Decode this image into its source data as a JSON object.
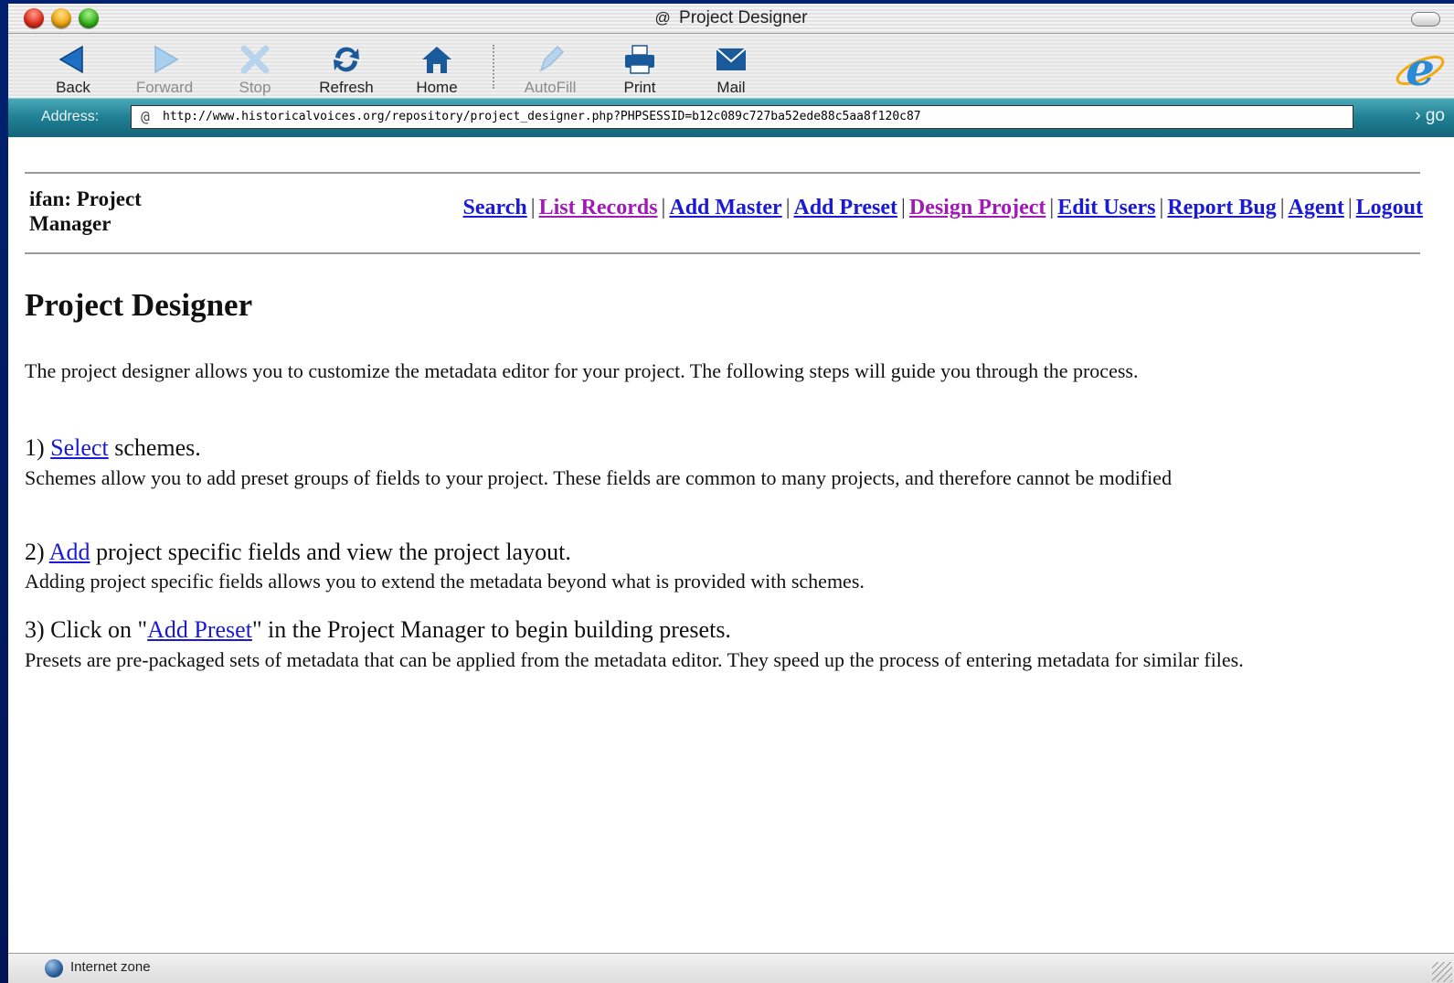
{
  "window": {
    "title": "Project Designer",
    "title_icon": "@"
  },
  "toolbar": {
    "back": "Back",
    "forward": "Forward",
    "stop": "Stop",
    "refresh": "Refresh",
    "home": "Home",
    "autofill": "AutoFill",
    "print": "Print",
    "mail": "Mail"
  },
  "address": {
    "label": "Address:",
    "url": "http://www.historicalvoices.org/repository/project_designer.php?PHPSESSID=b12c089c727ba52ede88c5aa8f120c87",
    "go": "go"
  },
  "page": {
    "manager_title": "ifan: Project Manager",
    "nav": [
      {
        "label": "Search",
        "visited": false
      },
      {
        "label": "List Records",
        "visited": true
      },
      {
        "label": "Add Master",
        "visited": false
      },
      {
        "label": "Add Preset",
        "visited": false
      },
      {
        "label": "Design Project",
        "visited": true
      },
      {
        "label": "Edit Users",
        "visited": false
      },
      {
        "label": "Report Bug",
        "visited": false
      },
      {
        "label": "Agent",
        "visited": false
      },
      {
        "label": "Logout",
        "visited": false
      }
    ],
    "heading": "Project Designer",
    "intro": "The project designer allows you to customize the metadata editor for your project. The following steps will guide you through the process.",
    "step1": {
      "prefix": "1) ",
      "link": "Select",
      "suffix": " schemes.",
      "desc": "Schemes allow you to add preset groups of fields to your project. These fields are common to many projects, and therefore cannot be modified"
    },
    "step2": {
      "prefix": "2) ",
      "link": "Add",
      "suffix": " project specific fields and view the project layout.",
      "desc": "Adding project specific fields allows you to extend the metadata beyond what is provided with schemes."
    },
    "step3": {
      "prefix": "3) Click on \"",
      "link": "Add Preset",
      "suffix": "\" in the Project Manager to begin building presets.",
      "desc": "Presets are pre-packaged sets of metadata that can be applied from the metadata editor. They speed up the process of entering metadata for similar files."
    }
  },
  "status": {
    "zone": "Internet zone"
  },
  "colors": {
    "link": "#1a1ad6",
    "visited_link": "#a01ab4",
    "address_bar": "#1f7f92"
  }
}
